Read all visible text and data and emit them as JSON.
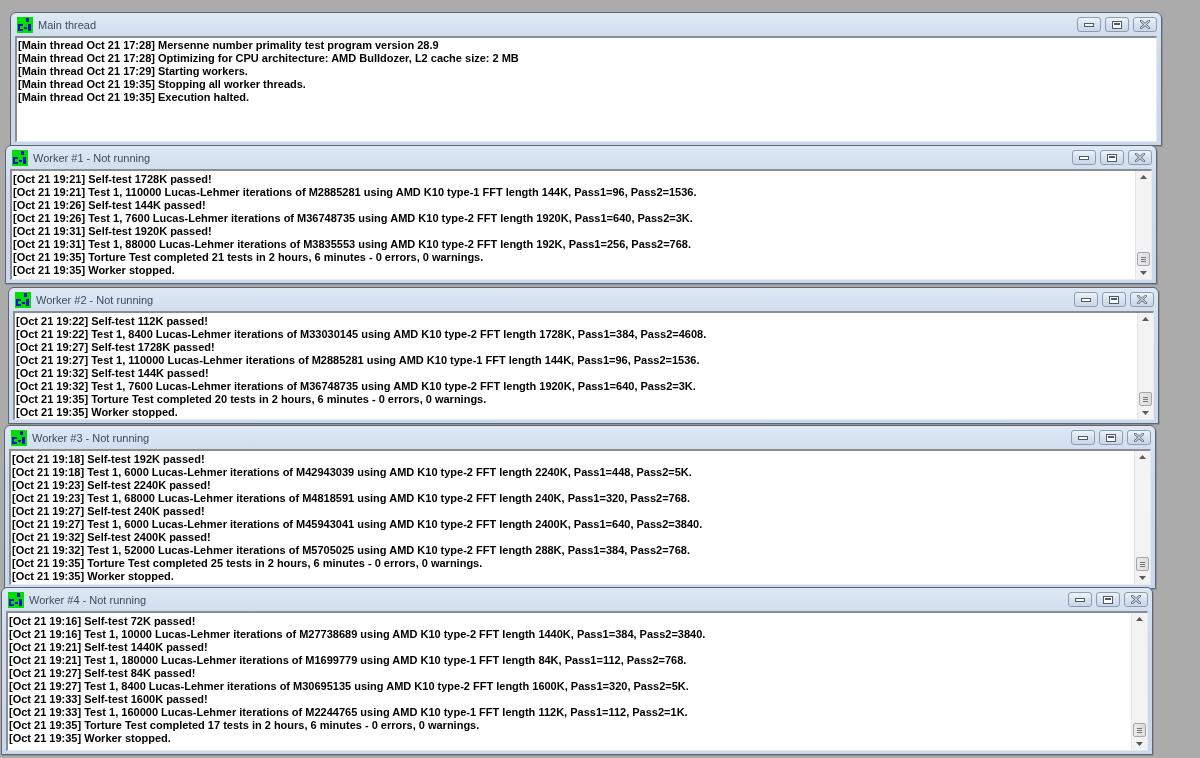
{
  "windows": [
    {
      "title": "Main thread",
      "scrollbar": false,
      "lines": [
        "[Main thread Oct 21 17:28] Mersenne number primality test program version 28.9",
        "[Main thread Oct 21 17:28] Optimizing for CPU architecture: AMD Bulldozer, L2 cache size: 2 MB",
        "[Main thread Oct 21 17:29] Starting workers.",
        "[Main thread Oct 21 19:35] Stopping all worker threads.",
        "[Main thread Oct 21 19:35] Execution halted."
      ]
    },
    {
      "title": "Worker #1 - Not running",
      "scrollbar": true,
      "lines": [
        "[Oct 21 19:21] Self-test 1728K passed!",
        "[Oct 21 19:21] Test 1, 110000 Lucas-Lehmer iterations of M2885281 using AMD K10 type-1 FFT length 144K, Pass1=96, Pass2=1536.",
        "[Oct 21 19:26] Self-test 144K passed!",
        "[Oct 21 19:26] Test 1, 7600 Lucas-Lehmer iterations of M36748735 using AMD K10 type-2 FFT length 1920K, Pass1=640, Pass2=3K.",
        "[Oct 21 19:31] Self-test 1920K passed!",
        "[Oct 21 19:31] Test 1, 88000 Lucas-Lehmer iterations of M3835553 using AMD K10 type-2 FFT length 192K, Pass1=256, Pass2=768.",
        "[Oct 21 19:35] Torture Test completed 21 tests in 2 hours, 6 minutes - 0 errors, 0 warnings.",
        "[Oct 21 19:35] Worker stopped."
      ]
    },
    {
      "title": "Worker #2 - Not running",
      "scrollbar": true,
      "lines": [
        "[Oct 21 19:22] Self-test 112K passed!",
        "[Oct 21 19:22] Test 1, 8400 Lucas-Lehmer iterations of M33030145 using AMD K10 type-2 FFT length 1728K, Pass1=384, Pass2=4608.",
        "[Oct 21 19:27] Self-test 1728K passed!",
        "[Oct 21 19:27] Test 1, 110000 Lucas-Lehmer iterations of M2885281 using AMD K10 type-1 FFT length 144K, Pass1=96, Pass2=1536.",
        "[Oct 21 19:32] Self-test 144K passed!",
        "[Oct 21 19:32] Test 1, 7600 Lucas-Lehmer iterations of M36748735 using AMD K10 type-2 FFT length 1920K, Pass1=640, Pass2=3K.",
        "[Oct 21 19:35] Torture Test completed 20 tests in 2 hours, 6 minutes - 0 errors, 0 warnings.",
        "[Oct 21 19:35] Worker stopped."
      ]
    },
    {
      "title": "Worker #3 - Not running",
      "scrollbar": true,
      "lines": [
        "[Oct 21 19:18] Self-test 192K passed!",
        "[Oct 21 19:18] Test 1, 6000 Lucas-Lehmer iterations of M42943039 using AMD K10 type-2 FFT length 2240K, Pass1=448, Pass2=5K.",
        "[Oct 21 19:23] Self-test 2240K passed!",
        "[Oct 21 19:23] Test 1, 68000 Lucas-Lehmer iterations of M4818591 using AMD K10 type-2 FFT length 240K, Pass1=320, Pass2=768.",
        "[Oct 21 19:27] Self-test 240K passed!",
        "[Oct 21 19:27] Test 1, 6000 Lucas-Lehmer iterations of M45943041 using AMD K10 type-2 FFT length 2400K, Pass1=640, Pass2=3840.",
        "[Oct 21 19:32] Self-test 2400K passed!",
        "[Oct 21 19:32] Test 1, 52000 Lucas-Lehmer iterations of M5705025 using AMD K10 type-2 FFT length 288K, Pass1=384, Pass2=768.",
        "[Oct 21 19:35] Torture Test completed 25 tests in 2 hours, 6 minutes - 0 errors, 0 warnings.",
        "[Oct 21 19:35] Worker stopped."
      ]
    },
    {
      "title": "Worker #4 - Not running",
      "scrollbar": true,
      "lines": [
        "[Oct 21 19:16] Self-test 72K passed!",
        "[Oct 21 19:16] Test 1, 10000 Lucas-Lehmer iterations of M27738689 using AMD K10 type-2 FFT length 1440K, Pass1=384, Pass2=3840.",
        "[Oct 21 19:21] Self-test 1440K passed!",
        "[Oct 21 19:21] Test 1, 180000 Lucas-Lehmer iterations of M1699779 using AMD K10 type-1 FFT length 84K, Pass1=112, Pass2=768.",
        "[Oct 21 19:27] Self-test 84K passed!",
        "[Oct 21 19:27] Test 1, 8400 Lucas-Lehmer iterations of M30695135 using AMD K10 type-2 FFT length 1600K, Pass1=320, Pass2=5K.",
        "[Oct 21 19:33] Self-test 1600K passed!",
        "[Oct 21 19:33] Test 1, 160000 Lucas-Lehmer iterations of M2244765 using AMD K10 type-1 FFT length 112K, Pass1=112, Pass2=1K.",
        "[Oct 21 19:35] Torture Test completed 17 tests in 2 hours, 6 minutes - 0 errors, 0 warnings.",
        "[Oct 21 19:35] Worker stopped."
      ]
    }
  ]
}
